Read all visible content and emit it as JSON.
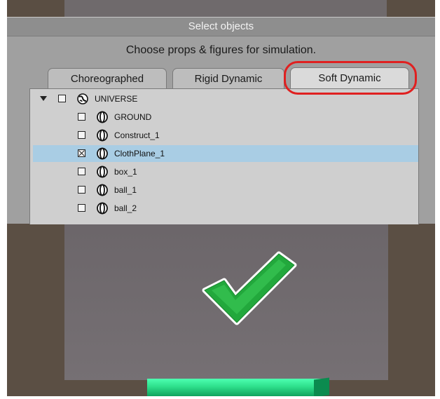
{
  "dialog": {
    "title": "Select objects",
    "subtitle": "Choose props & figures for simulation.",
    "tabs": [
      {
        "label": "Choreographed",
        "active": false
      },
      {
        "label": "Rigid Dynamic",
        "active": false
      },
      {
        "label": "Soft Dynamic",
        "active": true
      }
    ]
  },
  "tree": {
    "root": {
      "label": "UNIVERSE",
      "expanded": true,
      "checked": false,
      "icon": "globe-icon"
    },
    "items": [
      {
        "label": "GROUND",
        "checked": false,
        "icon": "prop-icon"
      },
      {
        "label": "Construct_1",
        "checked": false,
        "icon": "prop-icon"
      },
      {
        "label": "ClothPlane_1",
        "checked": true,
        "selected": true,
        "icon": "prop-icon"
      },
      {
        "label": "box_1",
        "checked": false,
        "icon": "prop-icon"
      },
      {
        "label": "ball_1",
        "checked": false,
        "icon": "prop-icon"
      },
      {
        "label": "ball_2",
        "checked": false,
        "icon": "prop-icon"
      }
    ]
  },
  "colors": {
    "highlight": "#a9cde4",
    "annotation_circle": "#e02020",
    "checkmark": "#22a83c"
  }
}
